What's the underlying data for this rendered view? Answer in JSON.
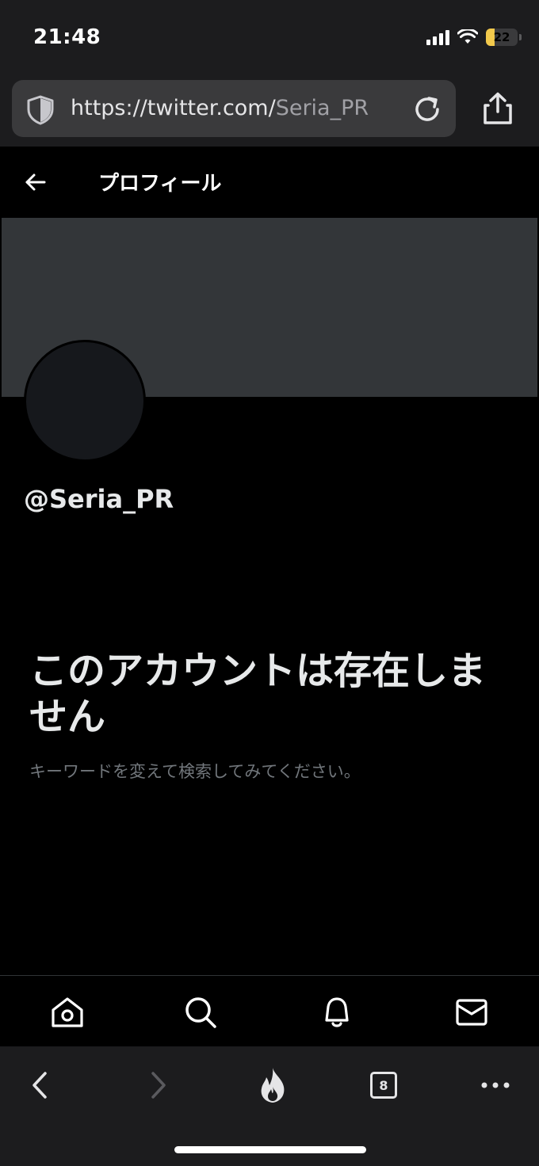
{
  "status": {
    "time": "21:48",
    "battery": "22",
    "icons": [
      "signal-icon",
      "wifi-icon",
      "battery-icon"
    ]
  },
  "browser": {
    "url_host": "https://twitter.com/",
    "url_path": "Seria_PR",
    "tabs_count": "8",
    "icons": [
      "shield-icon",
      "reload-icon",
      "share-icon",
      "back-icon",
      "forward-icon",
      "fire-icon",
      "tabs-icon",
      "more-icon"
    ]
  },
  "header": {
    "title": "プロフィール"
  },
  "profile": {
    "handle": "@Seria_PR"
  },
  "empty_state": {
    "title": "このアカウントは存在しません",
    "subtitle": "キーワードを変えて検索してみてください。"
  },
  "tabbar": {
    "icons": [
      "home-icon",
      "search-icon",
      "notifications-icon",
      "messages-icon"
    ]
  },
  "colors": {
    "background": "#000000",
    "banner": "#333639",
    "chrome": "#1c1c1e",
    "muted_text": "#71767b",
    "battery": "#f2c94c"
  }
}
